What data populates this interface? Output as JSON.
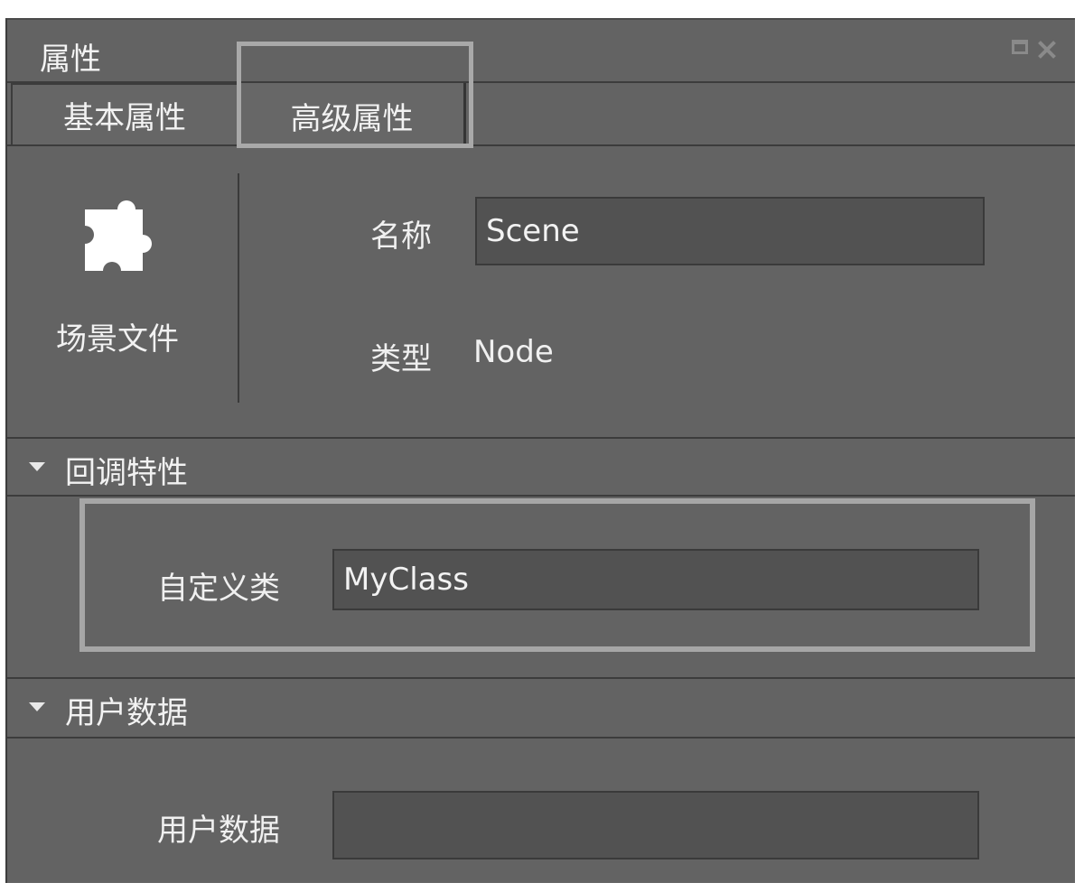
{
  "panel": {
    "title": "属性"
  },
  "tabs": [
    {
      "label": "基本属性",
      "active": false
    },
    {
      "label": "高级属性",
      "active": true
    }
  ],
  "node": {
    "icon": "puzzle-icon",
    "type_label": "场景文件",
    "name_label": "名称",
    "name_value": "Scene",
    "type_field_label": "类型",
    "type_value": "Node"
  },
  "callback_section": {
    "title": "回调特性",
    "custom_class_label": "自定义类",
    "custom_class_value": "MyClass"
  },
  "userdata_section": {
    "title": "用户数据",
    "field_label": "用户数据",
    "field_value": ""
  },
  "colors": {
    "panel_bg": "#636363",
    "field_bg": "#525252",
    "highlight_border": "#a6a6a6"
  }
}
